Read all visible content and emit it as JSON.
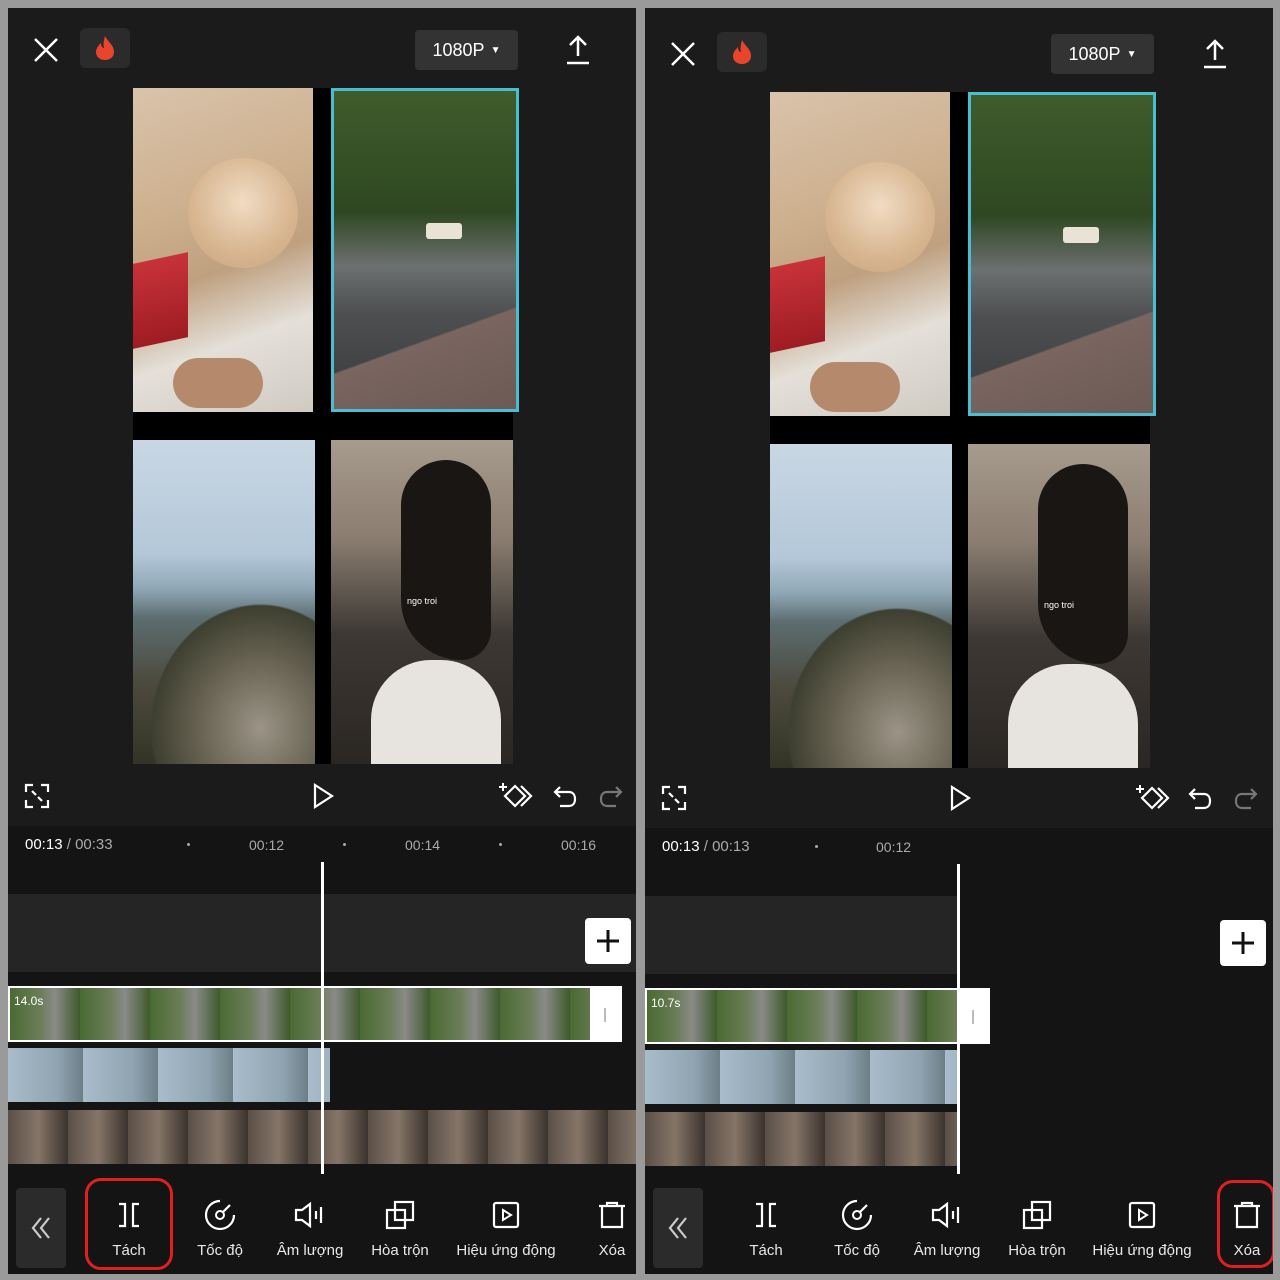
{
  "panels": [
    {
      "resolution": "1080P",
      "current_time": "00:13",
      "total_time": "00:33",
      "ticks": [
        "00:12",
        "00:14",
        "00:16"
      ],
      "caption": "ngo troi",
      "clip_duration": "14.0s"
    },
    {
      "resolution": "1080P",
      "current_time": "00:13",
      "total_time": "00:13",
      "ticks": [
        "00:12"
      ],
      "caption": "ngo troi",
      "clip_duration": "10.7s"
    }
  ],
  "time_separator": "/",
  "tools": [
    "Tách",
    "Tốc độ",
    "Âm lượng",
    "Hòa trộn",
    "Hiệu ứng động",
    "Xóa"
  ],
  "highlight_color": "#e02020",
  "selection_color": "#49bed3",
  "icons": {
    "close": "close-icon",
    "fire": "fire-icon",
    "export": "upload-icon",
    "fullscreen": "fullscreen-icon",
    "play": "play-icon",
    "keyframe": "keyframe-add-icon",
    "undo": "undo-icon",
    "redo": "redo-icon",
    "add": "plus-icon",
    "back": "double-chevron-left-icon",
    "split": "split-icon",
    "speed": "speed-icon",
    "volume": "volume-icon",
    "blend": "blend-icon",
    "animation": "animation-icon",
    "delete": "trash-icon"
  }
}
